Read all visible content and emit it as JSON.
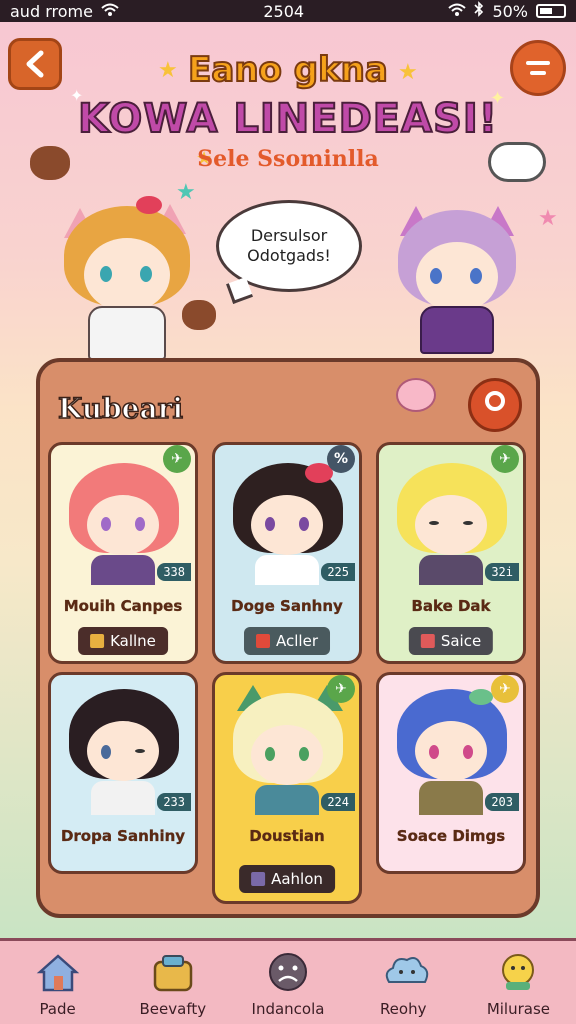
{
  "status_bar": {
    "carrier": "aud rrome",
    "time": "2504",
    "battery": "50%"
  },
  "header": {
    "title_line1": "Eano gkna",
    "title_line2": "KOWA LINEDEASI!",
    "subtitle": "Sele Ssominlla",
    "speech_line1": "Dersulsor",
    "speech_line2": "Odotgads!"
  },
  "panel": {
    "title": "Kubeari",
    "cards": [
      {
        "name": "Mouih Canpes",
        "number": "338",
        "tag": "Kallne",
        "badge_color": "#5aa64a",
        "bg": "#fbf3d6",
        "hair": "#f27a7a",
        "eyes": "#a06ac8",
        "body": "#6a4a8a"
      },
      {
        "name": "Doge Sanhny",
        "number": "225",
        "tag": "Acller",
        "badge_color": "#445566",
        "bg": "#cfe8f0",
        "hair": "#2e2020",
        "eyes": "#7a4aa0",
        "body": "#ffffff"
      },
      {
        "name": "Bake Dak",
        "number": "32i",
        "tag": "Saice",
        "badge_color": "#5aa64a",
        "bg": "#dff0c6",
        "hair": "#f6e25a",
        "eyes": "#333333",
        "body": "#5a4a6a"
      },
      {
        "name": "Dropa Sanhiny",
        "number": "233",
        "tag": "",
        "badge_color": "",
        "bg": "#d4ecf4",
        "hair": "#2a1e22",
        "eyes": "#4a6a9a",
        "body": "#f2f2f2"
      },
      {
        "name": "Doustian",
        "number": "224",
        "tag": "Aahlon",
        "badge_color": "#5aa64a",
        "bg": "#f8cf4a",
        "hair": "#f7f0c0",
        "eyes": "#4aa060",
        "body": "#4a8a9a"
      },
      {
        "name": "Soace Dimgs",
        "number": "203",
        "tag": "",
        "badge_color": "#e8c03a",
        "bg": "#fde2ea",
        "hair": "#4a6ad0",
        "eyes": "#d04a8a",
        "body": "#8a7a4a"
      }
    ]
  },
  "nav": [
    {
      "label": "Pade",
      "icon": "house-icon"
    },
    {
      "label": "Beevafty",
      "icon": "bag-icon"
    },
    {
      "label": "Indancola",
      "icon": "sad-face-icon"
    },
    {
      "label": "Reohy",
      "icon": "cloud-creature-icon"
    },
    {
      "label": "Milurase",
      "icon": "cat-mascot-icon"
    }
  ]
}
